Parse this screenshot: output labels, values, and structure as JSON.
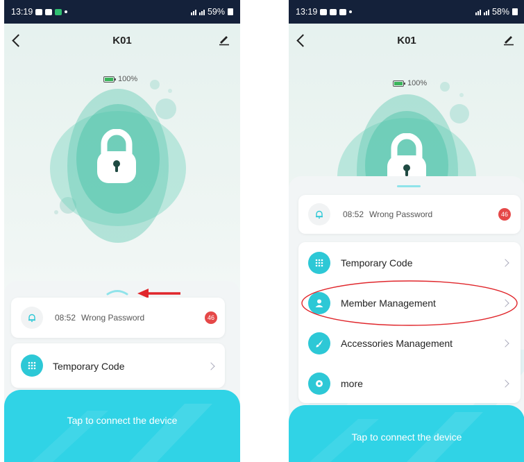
{
  "left_screen": {
    "status": {
      "time": "13:19",
      "battery": "59%"
    },
    "title": "K01",
    "battery_percent": "100%",
    "alert": {
      "time": "08:52",
      "text": "Wrong Password",
      "badge": "46"
    },
    "rows": [
      {
        "label": "Temporary Code"
      }
    ],
    "connect_label": "Tap to connect the device"
  },
  "right_screen": {
    "status": {
      "time": "13:19",
      "battery": "58%"
    },
    "title": "K01",
    "battery_percent": "100%",
    "alert": {
      "time": "08:52",
      "text": "Wrong Password",
      "badge": "46"
    },
    "rows": [
      {
        "label": "Temporary Code"
      },
      {
        "label": "Member Management"
      },
      {
        "label": "Accessories Management"
      },
      {
        "label": "more"
      }
    ],
    "connect_label": "Tap to connect the device"
  },
  "colors": {
    "accent": "#30d3e6",
    "lock_green": "#5ccdb3",
    "badge_red": "#e54848",
    "annotation_red": "#e0262b",
    "status_bar": "#14213a"
  },
  "icons": {
    "back": "chevron-left-icon",
    "edit": "pencil-icon",
    "lock": "padlock-icon",
    "alert": "bell-icon",
    "temporary_code": "keypad-icon",
    "member_management": "user-icon",
    "accessories_management": "brush-icon",
    "more": "gear-icon",
    "expand": "chevron-up-icon"
  }
}
